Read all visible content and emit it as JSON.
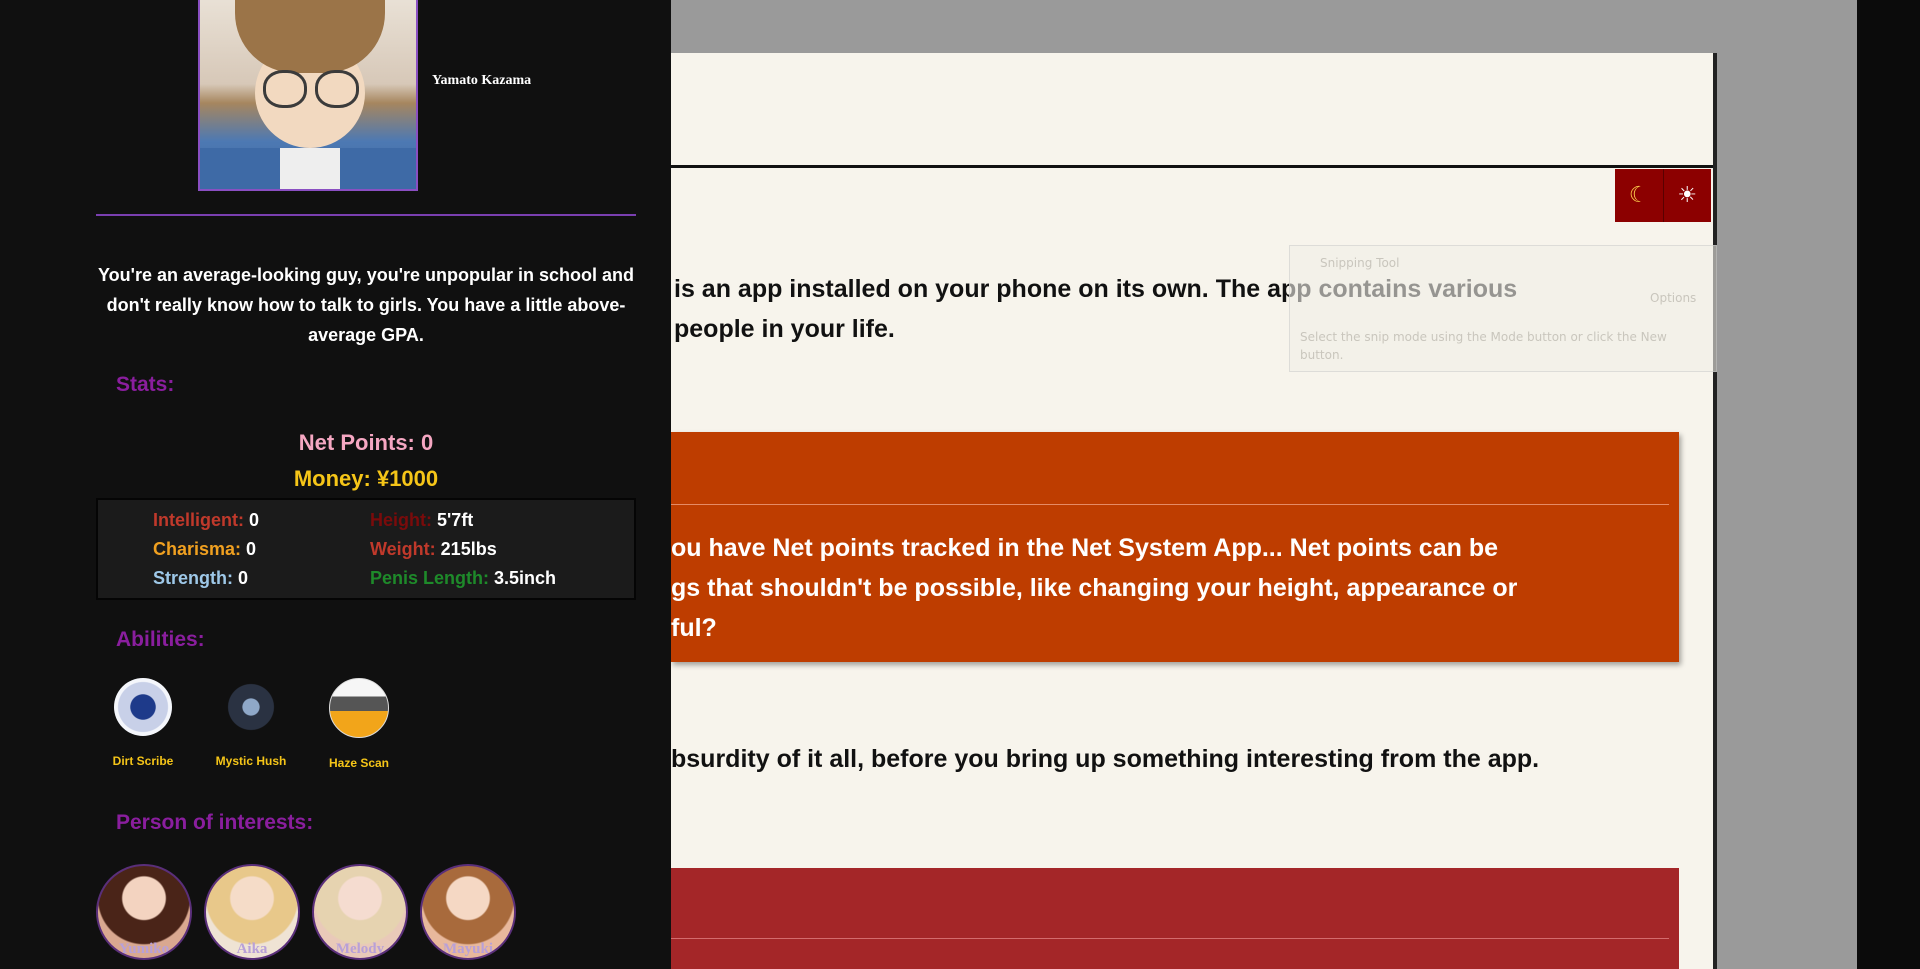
{
  "sidebar": {
    "character_name": "Yamato Kazama",
    "description": "You're an average-looking guy, you're unpopular in school and don't really know how to talk to girls. You have a little above-average GPA.",
    "stats_title": "Stats:",
    "net_points": "Net Points: 0",
    "money": "Money: ¥1000",
    "stats": [
      {
        "label": "Intelligent:",
        "value": "0",
        "color": "#c0392b"
      },
      {
        "label": "Height:",
        "value": "5'7ft",
        "color": "#7a0b0b"
      },
      {
        "label": "Charisma:",
        "value": "0",
        "color": "#f0a020"
      },
      {
        "label": "Weight:",
        "value": "215lbs",
        "color": "#c0392b"
      },
      {
        "label": "Strength:",
        "value": "0",
        "color": "#9ec8e8"
      },
      {
        "label": "Penis Length:",
        "value": "3.5inch",
        "color": "#1e8a2a"
      }
    ],
    "abilities_title": "Abilities:",
    "abilities": [
      {
        "name": "Dirt Scribe",
        "icon": "compass-emblem-icon"
      },
      {
        "name": "Mystic Hush",
        "icon": "mystic-emblem-icon"
      },
      {
        "name": "Haze Scan",
        "icon": "helmet-emblem-icon"
      }
    ],
    "poi_title": "Person of interests:",
    "persons": [
      "Yumiko",
      "Aika",
      "Melody",
      "Mayuki"
    ]
  },
  "toolbar": {
    "moon_icon": "☾",
    "sun_icon": "☀"
  },
  "content": {
    "intro_line1": "is an app installed on your phone on its own. The app contains various",
    "intro_line2": "people in your life.",
    "orange_line1": "ou have Net points tracked in the Net System App... Net points can be",
    "orange_line2": "gs that shouldn't be possible, like changing your height, appearance or",
    "orange_line3": "ful?",
    "mid_line": "bsurdity of it all, before you bring up something interesting from the app."
  },
  "snipping_tool": {
    "title": "Snipping Tool",
    "options": "Options",
    "help": "Select the snip mode using the Mode button or click the New button."
  },
  "colors": {
    "accent_purple": "#8a1e9e",
    "money_gold": "#f5c518",
    "orange_box": "#be3d00",
    "red_box": "#a42628"
  }
}
